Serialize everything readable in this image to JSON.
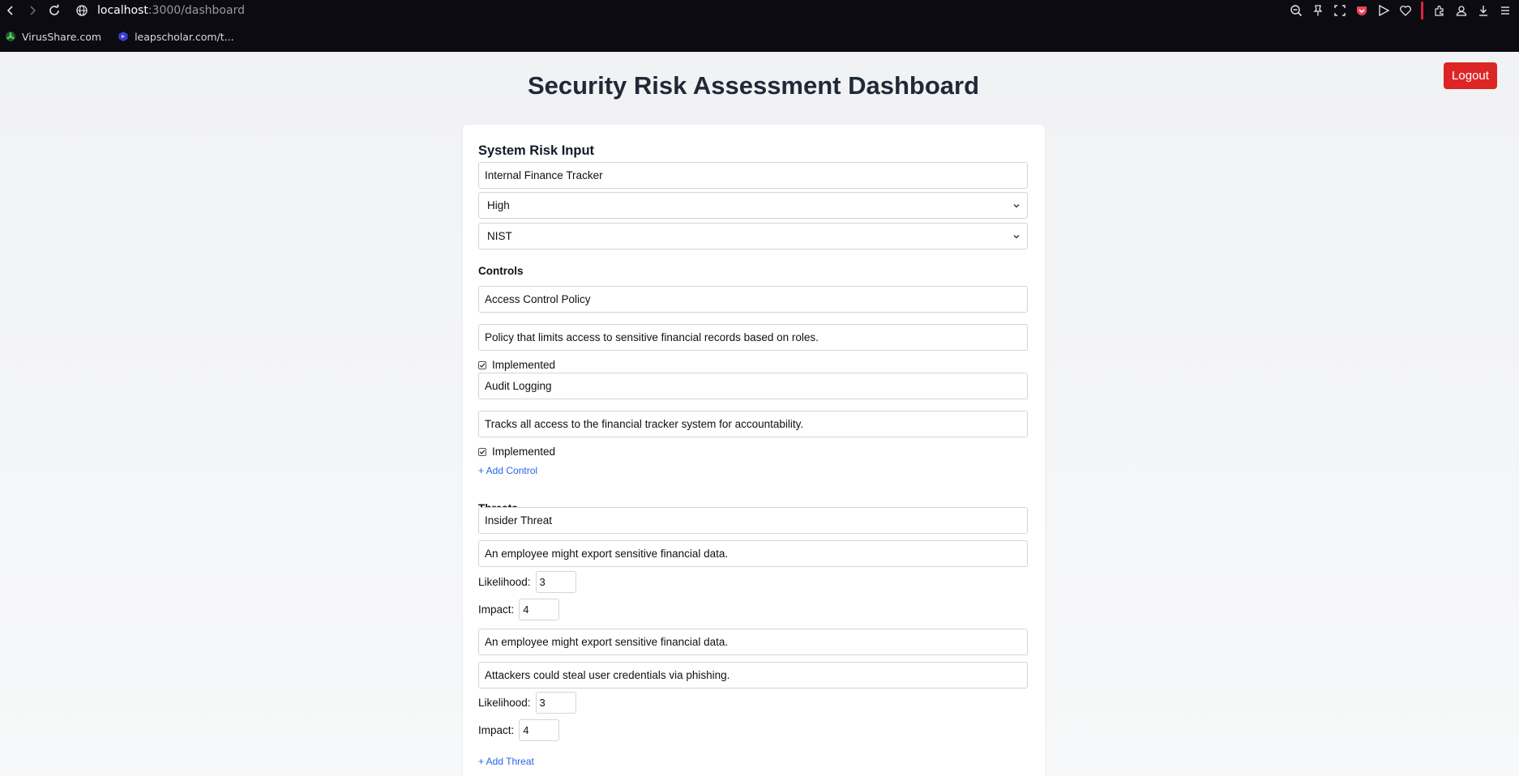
{
  "browser": {
    "url_host": "localhost",
    "url_path": ":3000/dashboard",
    "bookmarks": [
      {
        "label": "VirusShare.com",
        "icon": "biohazard-icon"
      },
      {
        "label": "leapscholar.com/t...",
        "icon": "leapscholar-icon"
      }
    ],
    "toolbar_icons": [
      "zoom-out-icon",
      "pin-icon",
      "screenshot-icon",
      "pocket-icon",
      "send-icon",
      "heart-icon",
      "extensions-icon",
      "profile-icon",
      "download-icon",
      "menu-icon"
    ],
    "colors": {
      "chrome_bg": "#0c0b12",
      "separator": "#e0243a",
      "pocket": "#ef4056"
    }
  },
  "header": {
    "title": "Security Risk Assessment Dashboard",
    "logout_label": "Logout"
  },
  "form": {
    "heading": "System Risk Input",
    "system_name": "Internal Finance Tracker",
    "risk_level": "High",
    "framework": "NIST",
    "controls_heading": "Controls",
    "controls": [
      {
        "name": "Access Control Policy",
        "description": "Policy that limits access to sensitive financial records based on roles.",
        "implemented_label": "Implemented",
        "implemented": true
      },
      {
        "name": "Audit Logging",
        "description": "Tracks all access to the financial tracker system for accountability.",
        "implemented_label": "Implemented",
        "implemented": true
      }
    ],
    "add_control_label": "+ Add Control",
    "threats_heading": "Threats",
    "threats": [
      {
        "name": "Insider Threat",
        "description": "An employee might export sensitive financial data.",
        "likelihood_label": "Likelihood:",
        "likelihood": "3",
        "impact_label": "Impact:",
        "impact": "4"
      },
      {
        "name": "An employee might export sensitive financial data.",
        "description": "Attackers could steal user credentials via phishing.",
        "likelihood_label": "Likelihood:",
        "likelihood": "3",
        "impact_label": "Impact:",
        "impact": "4"
      }
    ],
    "add_threat_label": "+ Add Threat"
  },
  "colors": {
    "accent_red": "#dc2626",
    "link_blue": "#2563eb",
    "title_text": "#1f2937"
  }
}
